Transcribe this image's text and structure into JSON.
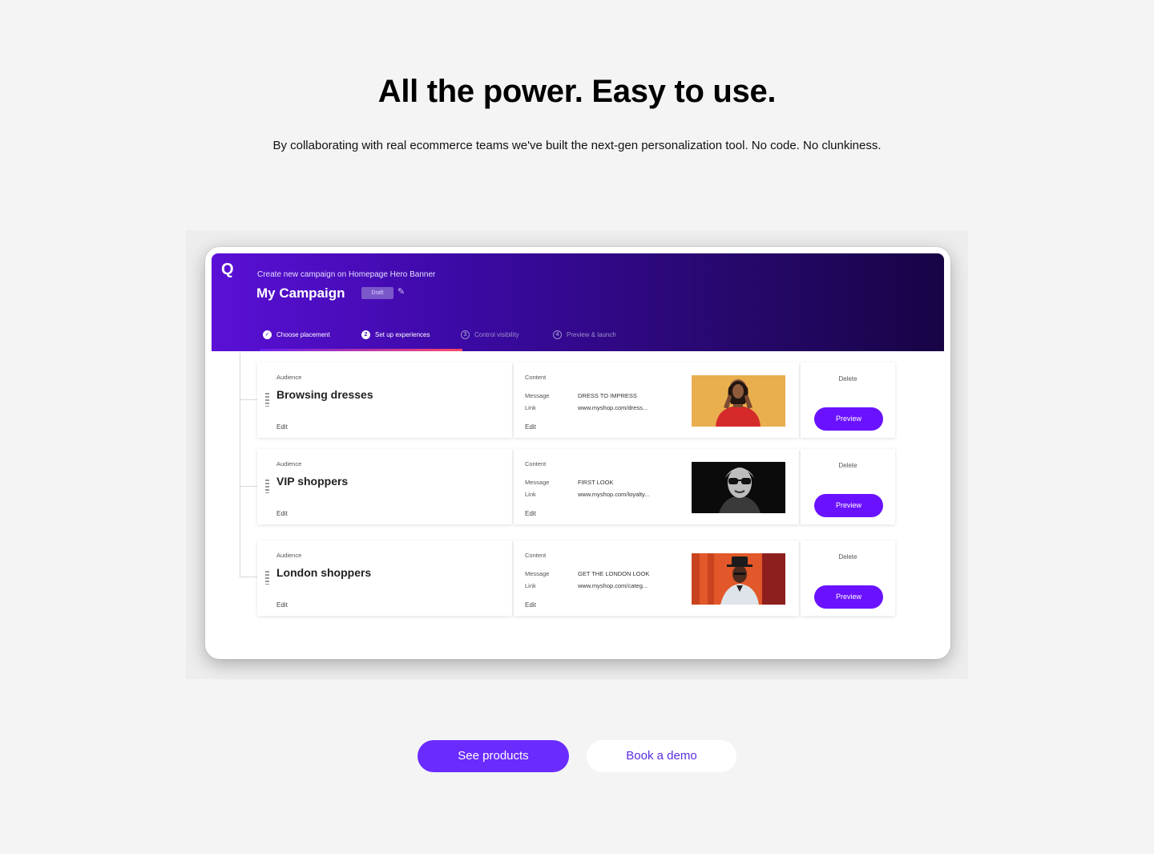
{
  "hero": {
    "title": "All the power. Easy to use.",
    "subtitle": "By collaborating with real ecommerce teams we've built the next-gen personalization tool. No code. No clunkiness."
  },
  "app": {
    "logo": "Q",
    "breadcrumb": "Create new campaign on Homepage Hero Banner",
    "campaign_title": "My Campaign",
    "status_badge": "Draft",
    "steps": [
      {
        "label": "Choose placement",
        "marker": "✓",
        "state": "done"
      },
      {
        "label": "Set up experiences",
        "marker": "2",
        "state": "active"
      },
      {
        "label": "Control visibility",
        "marker": "3",
        "state": "pending"
      },
      {
        "label": "Preview & launch",
        "marker": "4",
        "state": "pending"
      }
    ],
    "rows": [
      {
        "audience_label": "Audience",
        "audience": "Browsing dresses",
        "edit_label": "Edit",
        "content_label": "Content",
        "message_key": "Message",
        "message": "DRESS TO IMPRESS",
        "link_key": "Link",
        "link": "www.myshop.com/dress...",
        "content_edit": "Edit",
        "delete_label": "Delete",
        "preview_label": "Preview"
      },
      {
        "audience_label": "Audience",
        "audience": "VIP shoppers",
        "edit_label": "Edit",
        "content_label": "Content",
        "message_key": "Message",
        "message": "FIRST LOOK",
        "link_key": "Link",
        "link": "www.myshop.com/loyalty...",
        "content_edit": "Edit",
        "delete_label": "Delete",
        "preview_label": "Preview"
      },
      {
        "audience_label": "Audience",
        "audience": "London shoppers",
        "edit_label": "Edit",
        "content_label": "Content",
        "message_key": "Message",
        "message": "GET THE LONDON LOOK",
        "link_key": "Link",
        "link": "www.myshop.com/categ...",
        "content_edit": "Edit",
        "delete_label": "Delete",
        "preview_label": "Preview"
      }
    ]
  },
  "cta": {
    "primary": "See products",
    "secondary": "Book a demo"
  },
  "colors": {
    "accent": "#6a2bff",
    "header_start": "#5a10d6",
    "header_end": "#170445",
    "page_bg": "#f4f4f4"
  },
  "icons": [
    "logo-q-icon",
    "pencil-icon",
    "check-circle-icon",
    "drag-handle-icon"
  ]
}
